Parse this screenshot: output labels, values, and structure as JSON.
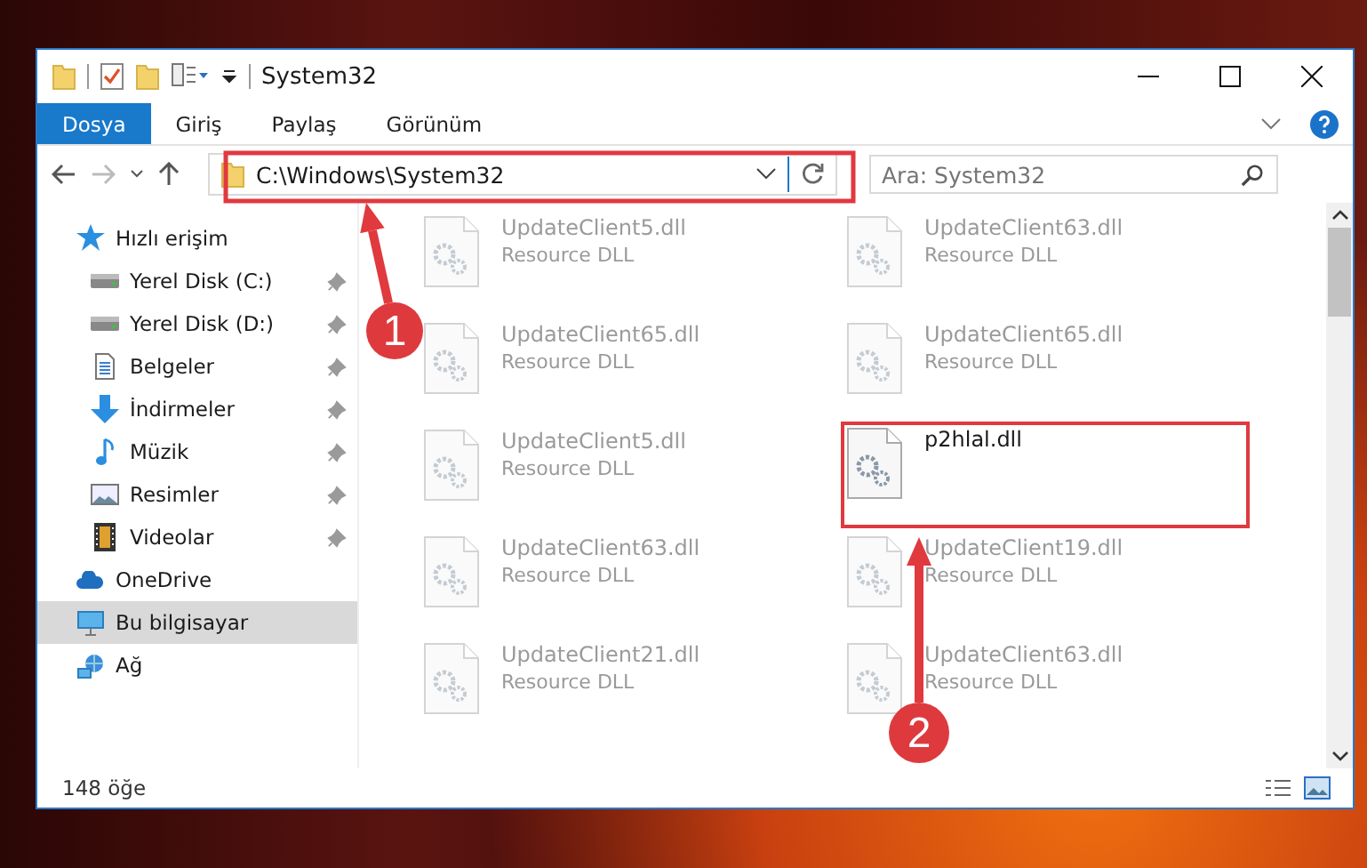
{
  "window": {
    "title": "System32"
  },
  "ribbon_tabs": [
    {
      "label": "Dosya",
      "selected": true
    },
    {
      "label": "Giriş",
      "selected": false
    },
    {
      "label": "Paylaş",
      "selected": false
    },
    {
      "label": "Görünüm",
      "selected": false
    }
  ],
  "address": {
    "value": "C:\\Windows\\System32"
  },
  "search": {
    "placeholder": "Ara: System32"
  },
  "sidebar": {
    "items": [
      {
        "label": "Hızlı erişim",
        "selected": false,
        "children": [
          {
            "label": "Yerel Disk (C:)",
            "pinned": true,
            "selected": false
          },
          {
            "label": "Yerel Disk (D:)",
            "pinned": true,
            "selected": false
          },
          {
            "label": "Belgeler",
            "pinned": true,
            "selected": false
          },
          {
            "label": "İndirmeler",
            "pinned": true,
            "selected": false
          },
          {
            "label": "Müzik",
            "pinned": true,
            "selected": false
          },
          {
            "label": "Resimler",
            "pinned": true,
            "selected": false
          },
          {
            "label": "Videolar",
            "pinned": true,
            "selected": false
          }
        ]
      },
      {
        "label": "OneDrive",
        "selected": false
      },
      {
        "label": "Bu bilgisayar",
        "selected": true
      },
      {
        "label": "Ağ",
        "selected": false
      }
    ]
  },
  "files": [
    {
      "name": "UpdateClient5.dll",
      "type": "Resource DLL",
      "blurred": true,
      "highlighted": false
    },
    {
      "name": "UpdateClient63.dll",
      "type": "Resource DLL",
      "blurred": true,
      "highlighted": false
    },
    {
      "name": "UpdateClient65.dll",
      "type": "Resource DLL",
      "blurred": true,
      "highlighted": false
    },
    {
      "name": "UpdateClient65.dll",
      "type": "Resource DLL",
      "blurred": true,
      "highlighted": false
    },
    {
      "name": "UpdateClient5.dll",
      "type": "Resource DLL",
      "blurred": true,
      "highlighted": false
    },
    {
      "name": "p2hlal.dll",
      "blurred": false,
      "highlighted": true
    },
    {
      "name": "UpdateClient63.dll",
      "type": "Resource DLL",
      "blurred": true,
      "highlighted": false
    },
    {
      "name": "UpdateClient19.dll",
      "type": "Resource DLL",
      "blurred": true,
      "highlighted": false
    },
    {
      "name": "UpdateClient21.dll",
      "type": "Resource DLL",
      "blurred": true,
      "highlighted": false
    },
    {
      "name": "UpdateClient63.dll",
      "type": "Resource DLL",
      "blurred": true,
      "highlighted": false
    }
  ],
  "status_bar": {
    "count": "148 öğe"
  },
  "annotations": [
    {
      "number": "1"
    },
    {
      "number": "2"
    }
  ]
}
